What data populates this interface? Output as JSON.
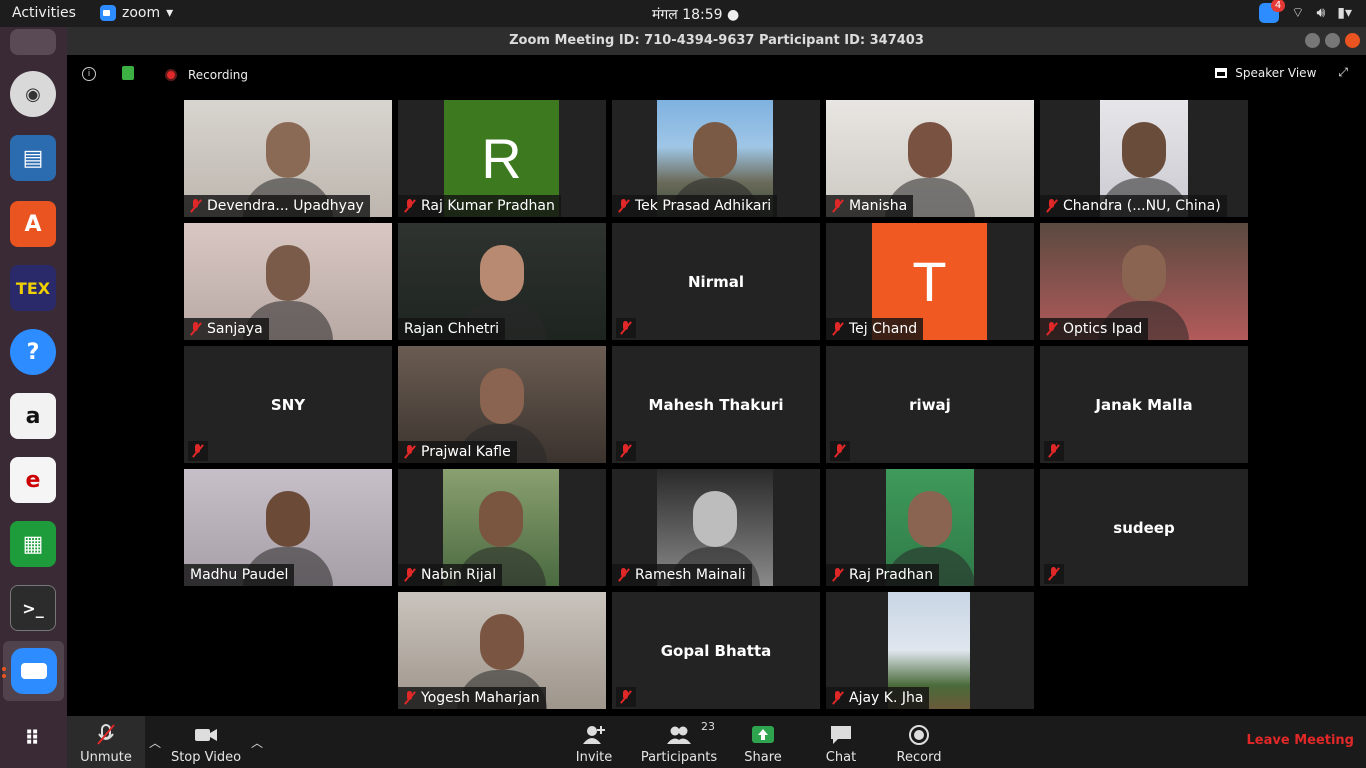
{
  "topbar": {
    "activities": "Activities",
    "app_name": "zoom",
    "clock": "मंगल 18:59 ●",
    "notif_count": "4"
  },
  "window": {
    "title": "Zoom Meeting ID: 710-4394-9637 Participant ID: 347403"
  },
  "meeting": {
    "recording_label": "Recording",
    "speaker_view_label": "Speaker View"
  },
  "tiles": [
    {
      "name": "Devendra... Upadhyay",
      "kind": "video",
      "muted": true
    },
    {
      "name": "Raj Kumar Pradhan",
      "kind": "letter",
      "letter": "R",
      "color": "#3d7a1f",
      "muted": true
    },
    {
      "name": "Tek Prasad Adhikari",
      "kind": "video",
      "muted": true
    },
    {
      "name": "Manisha",
      "kind": "video",
      "muted": true
    },
    {
      "name": "Chandra (...NU, China)",
      "kind": "video",
      "muted": true
    },
    {
      "name": "Sanjaya",
      "kind": "video",
      "muted": true
    },
    {
      "name": "Rajan Chhetri",
      "kind": "video",
      "muted": false,
      "active": true
    },
    {
      "name": "Nirmal",
      "kind": "text",
      "muted": true
    },
    {
      "name": "Tej Chand",
      "kind": "letter",
      "letter": "T",
      "color": "#f05a22",
      "muted": true
    },
    {
      "name": "Optics Ipad",
      "kind": "video",
      "muted": true
    },
    {
      "name": "SNY",
      "kind": "text",
      "muted": true
    },
    {
      "name": "Prajwal Kafle",
      "kind": "video",
      "muted": true
    },
    {
      "name": "Mahesh Thakuri",
      "kind": "text",
      "muted": true
    },
    {
      "name": "riwaj",
      "kind": "text",
      "muted": true
    },
    {
      "name": "Janak Malla",
      "kind": "text",
      "muted": true
    },
    {
      "name": "Madhu Paudel",
      "kind": "video",
      "muted": false
    },
    {
      "name": "Nabin Rijal",
      "kind": "video",
      "muted": true
    },
    {
      "name": "Ramesh Mainali",
      "kind": "video",
      "muted": true
    },
    {
      "name": "Raj Pradhan",
      "kind": "video",
      "muted": true
    },
    {
      "name": "sudeep",
      "kind": "text",
      "muted": true
    },
    {
      "name": "Yogesh Maharjan",
      "kind": "video",
      "muted": true
    },
    {
      "name": "Gopal Bhatta",
      "kind": "text",
      "muted": true
    },
    {
      "name": "Ajay K. Jha",
      "kind": "video",
      "muted": true
    }
  ],
  "toolbar": {
    "unmute": "Unmute",
    "stop_video": "Stop Video",
    "invite": "Invite",
    "participants": "Participants",
    "participants_count": "23",
    "share": "Share",
    "chat": "Chat",
    "record": "Record",
    "leave": "Leave Meeting"
  }
}
